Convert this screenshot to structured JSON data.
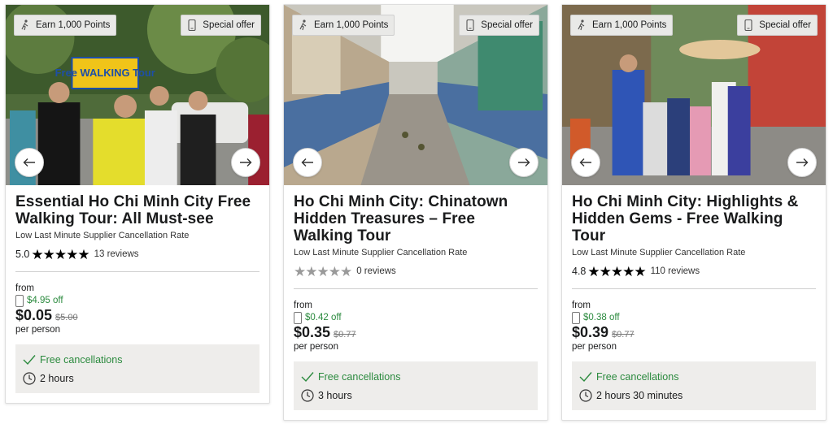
{
  "cards": [
    {
      "badge_left": "Earn 1,000 Points",
      "badge_right": "Special offer",
      "photo_sign": "Free WALKING Tour",
      "title": "Essential Ho Chi Minh City Free Walking Tour: All Must-see",
      "supplier_note": "Low Last Minute Supplier Cancellation Rate",
      "score": "5.0",
      "stars": "★★★★★",
      "reviews": "13 reviews",
      "from_label": "from",
      "discount": "$4.95 off",
      "price": "$0.05",
      "old_price": "$5.00",
      "per_person": "per person",
      "cancellation": "Free cancellations",
      "duration": "2 hours"
    },
    {
      "badge_left": "Earn 1,000 Points",
      "badge_right": "Special offer",
      "title": "Ho Chi Minh City: Chinatown Hidden Treasures – Free Walking Tour",
      "supplier_note": "Low Last Minute Supplier Cancellation Rate",
      "stars": "★★★★★",
      "reviews": "0 reviews",
      "from_label": "from",
      "discount": "$0.42 off",
      "price": "$0.35",
      "old_price": "$0.77",
      "per_person": "per person",
      "cancellation": "Free cancellations",
      "duration": "3 hours"
    },
    {
      "badge_left": "Earn 1,000 Points",
      "badge_right": "Special offer",
      "title": "Ho Chi Minh City: Highlights & Hidden Gems - Free Walking Tour",
      "supplier_note": "Low Last Minute Supplier Cancellation Rate",
      "score": "4.8",
      "stars": "★★★★★",
      "reviews": "110 reviews",
      "from_label": "from",
      "discount": "$0.38 off",
      "price": "$0.39",
      "old_price": "$0.77",
      "per_person": "per person",
      "cancellation": "Free cancellations",
      "duration": "2 hours 30 minutes"
    }
  ],
  "icons": {
    "badge_left": "points-walker-icon",
    "badge_right": "phone-icon",
    "prev": "arrow-left-icon",
    "next": "arrow-right-icon",
    "cancellation": "check-icon",
    "duration": "clock-icon"
  },
  "colors": {
    "green": "#2b8a3e",
    "feature_bg": "#eeedeb",
    "badge_bg": "#e9e9e7"
  }
}
